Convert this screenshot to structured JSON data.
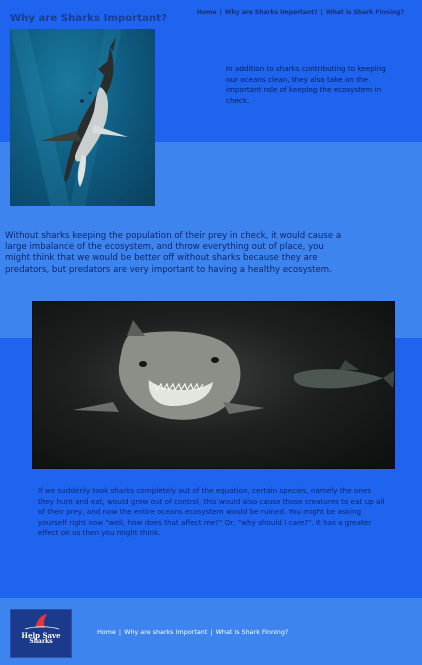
{
  "header": {
    "title": "Why are Sharks Important?",
    "nav": {
      "home": "Home",
      "why": "Why are Sharks Important?",
      "finning": "What is Shark Finning?",
      "separator": "|"
    }
  },
  "intro": {
    "text": "In addition to sharks contributing to keeping our oceans clean, they also take on the important role of keeping the ecosystem in check."
  },
  "main": {
    "paragraph": "Without sharks keeping the population of their prey in check, it would cause a large imbalance of the ecosystem, and throw everything out of place, you might think that we would be better off without sharks because they are predators, but predators are very important to having a healthy ecosystem.",
    "paragraph2": "If we suddenly took sharks completely out of the equation, certain species, namely the ones they hunt and eat, would grow out of control, this would also cause those creatures to eat up all of their prey, and now the entire oceans ecosystem would be ruined. You might be asking yourself right now \"well, how does that affect me?\" Or, \"why should I care?\". It has a greater effect on us then you might think."
  },
  "footer": {
    "logo": {
      "line1": "Help Save",
      "line2": "Sharks"
    },
    "nav": {
      "home": "Home",
      "why": "Why are sharks Important",
      "finning": "What is Shark Finning?",
      "separator": "|"
    }
  },
  "colors": {
    "background": "#1f66f0",
    "band_light": "#3d84ee",
    "title": "#1c3d8f",
    "text": "#10266a"
  },
  "icons": [
    "shark-photo",
    "shark-close-up-photo",
    "help-save-sharks-logo"
  ]
}
